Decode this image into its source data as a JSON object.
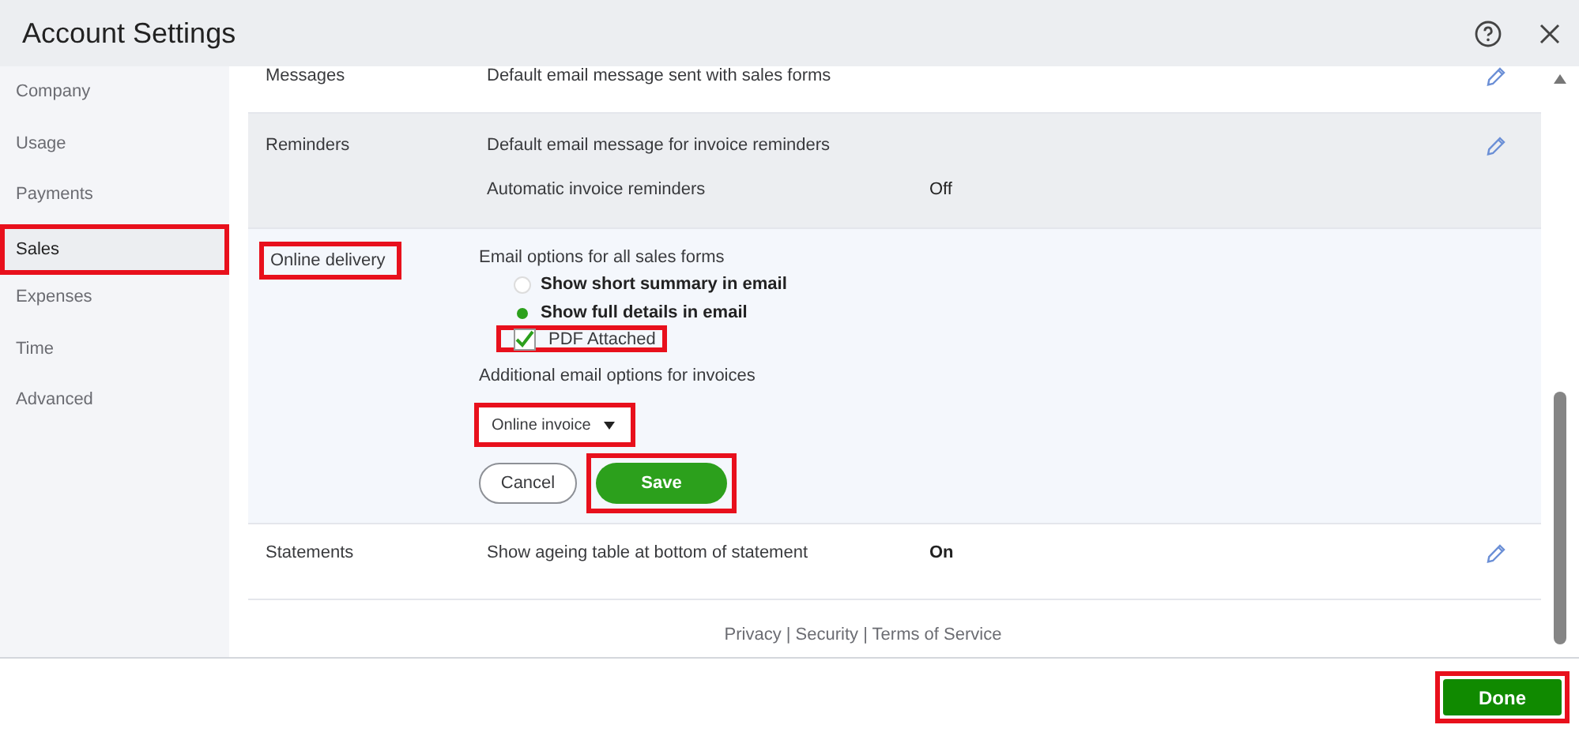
{
  "window": {
    "title": "Account Settings"
  },
  "sidebar": {
    "items": [
      {
        "label": "Company",
        "selected": false,
        "highlighted": false
      },
      {
        "label": "Usage",
        "selected": false,
        "highlighted": false
      },
      {
        "label": "Payments",
        "selected": false,
        "highlighted": false
      },
      {
        "label": "Sales",
        "selected": true,
        "highlighted": true
      },
      {
        "label": "Expenses",
        "selected": false,
        "highlighted": false
      },
      {
        "label": "Time",
        "selected": false,
        "highlighted": false
      },
      {
        "label": "Advanced",
        "selected": false,
        "highlighted": false
      }
    ]
  },
  "sections": [
    {
      "kind": "summary",
      "label": "Messages",
      "hovered": false,
      "lines": [
        {
          "text": "Default email message sent with sales forms"
        }
      ]
    },
    {
      "kind": "summary",
      "label": "Reminders",
      "hovered": true,
      "lines": [
        {
          "text": "Default email message for invoice reminders"
        },
        {
          "text": "Automatic invoice reminders",
          "value": "Off"
        }
      ]
    },
    {
      "kind": "editing",
      "label": "Online delivery",
      "highlighted": true,
      "heading": "Email options for all sales forms",
      "radios": [
        {
          "label": "Show short summary in email",
          "selected": false
        },
        {
          "label": "Show full details in email",
          "selected": true
        }
      ],
      "checkbox": {
        "label": "PDF Attached",
        "checked": true,
        "highlighted": true
      },
      "subheading": "Additional email options for invoices",
      "dropdown": {
        "value": "Online invoice",
        "highlighted": true
      },
      "cancel": {
        "label": "Cancel"
      },
      "save": {
        "label": "Save",
        "highlighted": true
      }
    },
    {
      "kind": "summary",
      "label": "Statements",
      "hovered": false,
      "lines": [
        {
          "text": "Show ageing table at bottom of statement",
          "value": "On"
        }
      ]
    }
  ],
  "footer_links": "Privacy | Security | Terms of Service",
  "done_button": {
    "label": "Done",
    "highlighted": true
  }
}
